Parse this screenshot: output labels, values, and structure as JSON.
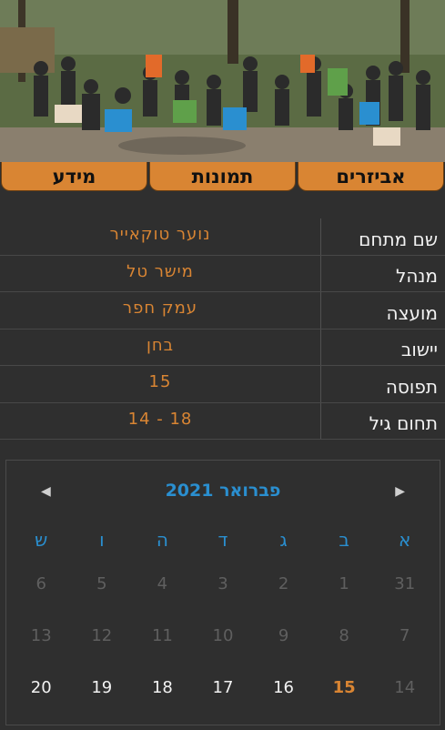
{
  "tabs": [
    {
      "label": "אביזרים"
    },
    {
      "label": "תמונות"
    },
    {
      "label": "מידע"
    }
  ],
  "info": [
    {
      "label": "שם מתחם",
      "value": "נוער טוקאייר"
    },
    {
      "label": "מנהל",
      "value": "מישר טל"
    },
    {
      "label": "מועצה",
      "value": "עמק חפר"
    },
    {
      "label": "יישוב",
      "value": "בחן"
    },
    {
      "label": "תפוסה",
      "value": "15"
    },
    {
      "label": "תחום גיל",
      "value": "14 - 18"
    }
  ],
  "calendar": {
    "title": "פברואר 2021",
    "prev_icon": "◀",
    "next_icon": "▶",
    "weekdays": [
      "א",
      "ב",
      "ג",
      "ד",
      "ה",
      "ו",
      "ש"
    ],
    "weeks": [
      [
        "31",
        "1",
        "2",
        "3",
        "4",
        "5",
        "6"
      ],
      [
        "7",
        "8",
        "9",
        "10",
        "11",
        "12",
        "13"
      ],
      [
        "14",
        "15",
        "16",
        "17",
        "18",
        "19",
        "20"
      ]
    ],
    "today": "15"
  },
  "colors": {
    "accent": "#d98533",
    "calendar_blue": "#2a8fd0",
    "background": "#2f2f2f"
  }
}
